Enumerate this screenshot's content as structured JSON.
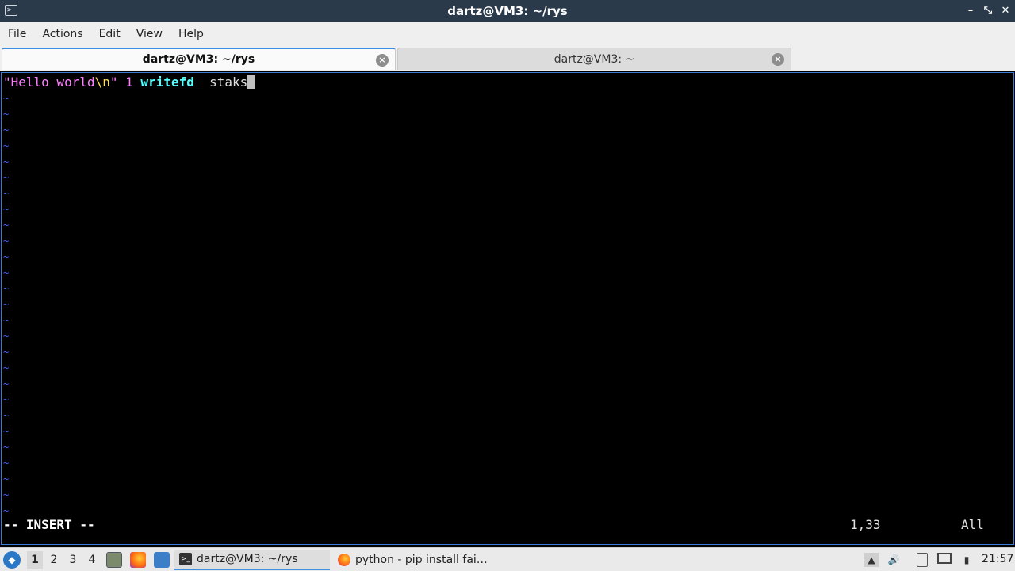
{
  "window": {
    "title": "dartz@VM3: ~/rys",
    "controls": {
      "minimize": "–",
      "maximize": "⤡",
      "close": "✕"
    }
  },
  "menubar": {
    "items": [
      "File",
      "Actions",
      "Edit",
      "View",
      "Help"
    ]
  },
  "tabs": [
    {
      "label": "dartz@VM3: ~/rys",
      "active": true
    },
    {
      "label": "dartz@VM3: ~",
      "active": false
    }
  ],
  "editor": {
    "tokens": {
      "string_open": "\"Hello world",
      "escape": "\\n",
      "string_close": "\"",
      "number": "1",
      "keyword": "writefd",
      "plain": "staks"
    },
    "tilde_char": "~",
    "mode": "-- INSERT --",
    "position": "1,33",
    "scroll": "All"
  },
  "taskbar": {
    "workspaces": [
      "1",
      "2",
      "3",
      "4"
    ],
    "active_workspace": "1",
    "tasks": [
      {
        "label": "dartz@VM3: ~/rys",
        "icon": "terminal-icon",
        "active": true
      },
      {
        "label": "python - pip install fai…",
        "icon": "firefox-icon",
        "active": false
      }
    ],
    "clock": "21:57"
  },
  "colors": {
    "titlebar": "#2b3a4a",
    "accent": "#3b8ee0",
    "string": "#ff80ff",
    "keyword": "#55ffff",
    "tilde": "#4466ff"
  }
}
